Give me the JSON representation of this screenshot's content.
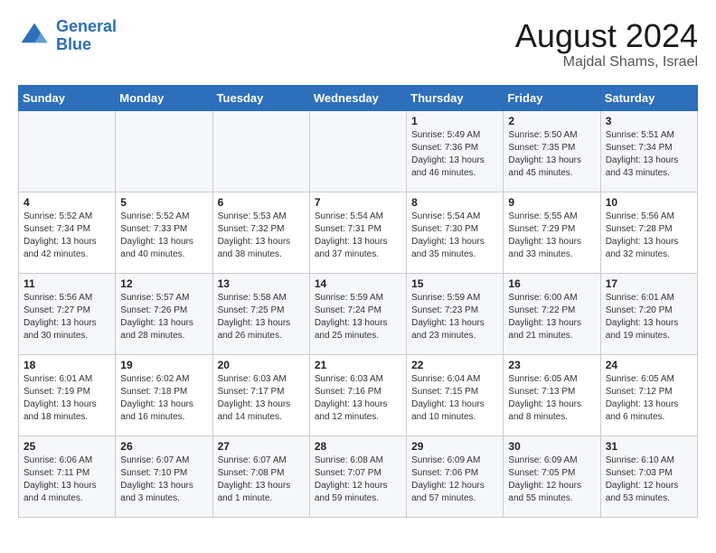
{
  "logo": {
    "text_general": "General",
    "text_blue": "Blue"
  },
  "header": {
    "title": "August 2024",
    "subtitle": "Majdal Shams, Israel"
  },
  "days_of_week": [
    "Sunday",
    "Monday",
    "Tuesday",
    "Wednesday",
    "Thursday",
    "Friday",
    "Saturday"
  ],
  "weeks": [
    [
      {
        "num": "",
        "info": ""
      },
      {
        "num": "",
        "info": ""
      },
      {
        "num": "",
        "info": ""
      },
      {
        "num": "",
        "info": ""
      },
      {
        "num": "1",
        "info": "Sunrise: 5:49 AM\nSunset: 7:36 PM\nDaylight: 13 hours\nand 46 minutes."
      },
      {
        "num": "2",
        "info": "Sunrise: 5:50 AM\nSunset: 7:35 PM\nDaylight: 13 hours\nand 45 minutes."
      },
      {
        "num": "3",
        "info": "Sunrise: 5:51 AM\nSunset: 7:34 PM\nDaylight: 13 hours\nand 43 minutes."
      }
    ],
    [
      {
        "num": "4",
        "info": "Sunrise: 5:52 AM\nSunset: 7:34 PM\nDaylight: 13 hours\nand 42 minutes."
      },
      {
        "num": "5",
        "info": "Sunrise: 5:52 AM\nSunset: 7:33 PM\nDaylight: 13 hours\nand 40 minutes."
      },
      {
        "num": "6",
        "info": "Sunrise: 5:53 AM\nSunset: 7:32 PM\nDaylight: 13 hours\nand 38 minutes."
      },
      {
        "num": "7",
        "info": "Sunrise: 5:54 AM\nSunset: 7:31 PM\nDaylight: 13 hours\nand 37 minutes."
      },
      {
        "num": "8",
        "info": "Sunrise: 5:54 AM\nSunset: 7:30 PM\nDaylight: 13 hours\nand 35 minutes."
      },
      {
        "num": "9",
        "info": "Sunrise: 5:55 AM\nSunset: 7:29 PM\nDaylight: 13 hours\nand 33 minutes."
      },
      {
        "num": "10",
        "info": "Sunrise: 5:56 AM\nSunset: 7:28 PM\nDaylight: 13 hours\nand 32 minutes."
      }
    ],
    [
      {
        "num": "11",
        "info": "Sunrise: 5:56 AM\nSunset: 7:27 PM\nDaylight: 13 hours\nand 30 minutes."
      },
      {
        "num": "12",
        "info": "Sunrise: 5:57 AM\nSunset: 7:26 PM\nDaylight: 13 hours\nand 28 minutes."
      },
      {
        "num": "13",
        "info": "Sunrise: 5:58 AM\nSunset: 7:25 PM\nDaylight: 13 hours\nand 26 minutes."
      },
      {
        "num": "14",
        "info": "Sunrise: 5:59 AM\nSunset: 7:24 PM\nDaylight: 13 hours\nand 25 minutes."
      },
      {
        "num": "15",
        "info": "Sunrise: 5:59 AM\nSunset: 7:23 PM\nDaylight: 13 hours\nand 23 minutes."
      },
      {
        "num": "16",
        "info": "Sunrise: 6:00 AM\nSunset: 7:22 PM\nDaylight: 13 hours\nand 21 minutes."
      },
      {
        "num": "17",
        "info": "Sunrise: 6:01 AM\nSunset: 7:20 PM\nDaylight: 13 hours\nand 19 minutes."
      }
    ],
    [
      {
        "num": "18",
        "info": "Sunrise: 6:01 AM\nSunset: 7:19 PM\nDaylight: 13 hours\nand 18 minutes."
      },
      {
        "num": "19",
        "info": "Sunrise: 6:02 AM\nSunset: 7:18 PM\nDaylight: 13 hours\nand 16 minutes."
      },
      {
        "num": "20",
        "info": "Sunrise: 6:03 AM\nSunset: 7:17 PM\nDaylight: 13 hours\nand 14 minutes."
      },
      {
        "num": "21",
        "info": "Sunrise: 6:03 AM\nSunset: 7:16 PM\nDaylight: 13 hours\nand 12 minutes."
      },
      {
        "num": "22",
        "info": "Sunrise: 6:04 AM\nSunset: 7:15 PM\nDaylight: 13 hours\nand 10 minutes."
      },
      {
        "num": "23",
        "info": "Sunrise: 6:05 AM\nSunset: 7:13 PM\nDaylight: 13 hours\nand 8 minutes."
      },
      {
        "num": "24",
        "info": "Sunrise: 6:05 AM\nSunset: 7:12 PM\nDaylight: 13 hours\nand 6 minutes."
      }
    ],
    [
      {
        "num": "25",
        "info": "Sunrise: 6:06 AM\nSunset: 7:11 PM\nDaylight: 13 hours\nand 4 minutes."
      },
      {
        "num": "26",
        "info": "Sunrise: 6:07 AM\nSunset: 7:10 PM\nDaylight: 13 hours\nand 3 minutes."
      },
      {
        "num": "27",
        "info": "Sunrise: 6:07 AM\nSunset: 7:08 PM\nDaylight: 13 hours\nand 1 minute."
      },
      {
        "num": "28",
        "info": "Sunrise: 6:08 AM\nSunset: 7:07 PM\nDaylight: 12 hours\nand 59 minutes."
      },
      {
        "num": "29",
        "info": "Sunrise: 6:09 AM\nSunset: 7:06 PM\nDaylight: 12 hours\nand 57 minutes."
      },
      {
        "num": "30",
        "info": "Sunrise: 6:09 AM\nSunset: 7:05 PM\nDaylight: 12 hours\nand 55 minutes."
      },
      {
        "num": "31",
        "info": "Sunrise: 6:10 AM\nSunset: 7:03 PM\nDaylight: 12 hours\nand 53 minutes."
      }
    ]
  ]
}
